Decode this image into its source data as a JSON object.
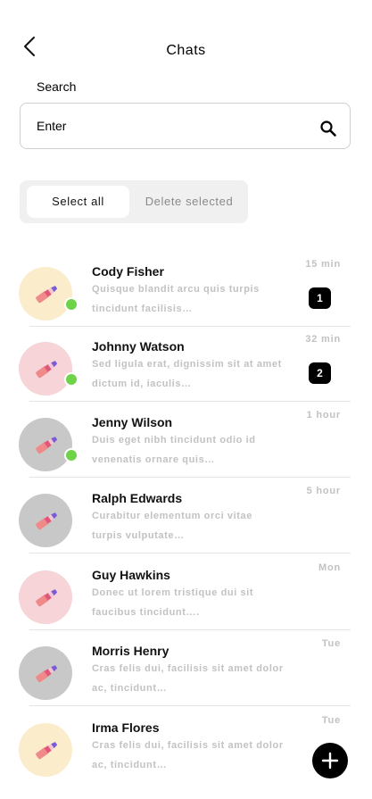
{
  "header": {
    "title": "Chats",
    "back_icon": "chevron-left-icon"
  },
  "search": {
    "label": "Search",
    "placeholder": "Enter",
    "value": "",
    "icon": "search-icon"
  },
  "segment": {
    "select_all": "Select all",
    "delete_selected": "Delete selected",
    "active": "select_all"
  },
  "colors": {
    "online": "#6fd34a",
    "avatar_yellow": "#fbeccb",
    "avatar_pink": "#f6d4d7",
    "avatar_gray": "#c8c8c8",
    "muted_text": "#c2c2c2",
    "badge": "#000000"
  },
  "chats": [
    {
      "name": "Cody Fisher",
      "preview": "Quisque blandit arcu quis turpis tincidunt facilisis…",
      "time": "15 min",
      "unread": "1",
      "online": true,
      "avatar_color": "yellow"
    },
    {
      "name": "Johnny Watson",
      "preview": "Sed ligula erat, dignissim sit at amet dictum id, iaculis…",
      "time": "32 min",
      "unread": "2",
      "online": true,
      "avatar_color": "pink"
    },
    {
      "name": "Jenny Wilson",
      "preview": "Duis eget nibh tincidunt odio id venenatis ornare quis…",
      "time": "1 hour",
      "unread": "",
      "online": true,
      "avatar_color": "gray"
    },
    {
      "name": "Ralph Edwards",
      "preview": "Curabitur elementum orci vitae turpis vulputate…",
      "time": "5 hour",
      "unread": "",
      "online": false,
      "avatar_color": "gray"
    },
    {
      "name": "Guy Hawkins",
      "preview": "Donec ut lorem tristique dui sit faucibus tincidunt….",
      "time": "Mon",
      "unread": "",
      "online": false,
      "avatar_color": "pink"
    },
    {
      "name": "Morris Henry",
      "preview": "Cras felis dui, facilisis sit amet dolor ac, tincidunt…",
      "time": "Tue",
      "unread": "",
      "online": false,
      "avatar_color": "gray"
    },
    {
      "name": "Irma Flores",
      "preview": "Cras felis dui, facilisis sit amet dolor ac, tincidunt…",
      "time": "Tue",
      "unread": "",
      "online": false,
      "avatar_color": "yellow"
    }
  ],
  "fab": {
    "icon": "plus-icon"
  }
}
